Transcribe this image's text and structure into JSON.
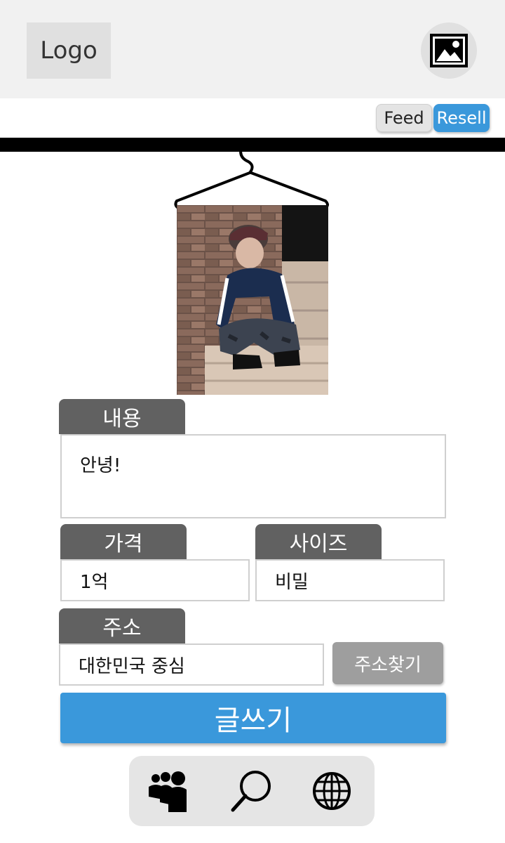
{
  "header": {
    "logo_text": "Logo",
    "profile_icon": "image-icon"
  },
  "mode_toggle": {
    "feed_label": "Feed",
    "resell_label": "Resell",
    "active": "Resell",
    "active_color": "#3a98db"
  },
  "product_photo": {
    "icon": "hanger-icon"
  },
  "form": {
    "content": {
      "label": "내용",
      "value": "안녕!"
    },
    "price": {
      "label": "가격",
      "value": "1억"
    },
    "size": {
      "label": "사이즈",
      "value": "비밀"
    },
    "address": {
      "label": "주소",
      "value": "대한민국 중심",
      "search_button": "주소찾기"
    },
    "submit_label": "글쓰기"
  },
  "bottom_nav": {
    "items": [
      {
        "icon": "users-icon"
      },
      {
        "icon": "search-icon"
      },
      {
        "icon": "globe-icon"
      }
    ]
  },
  "colors": {
    "primary": "#3a98db",
    "label_tab": "#616161",
    "header_bg": "#f1f1f1"
  }
}
